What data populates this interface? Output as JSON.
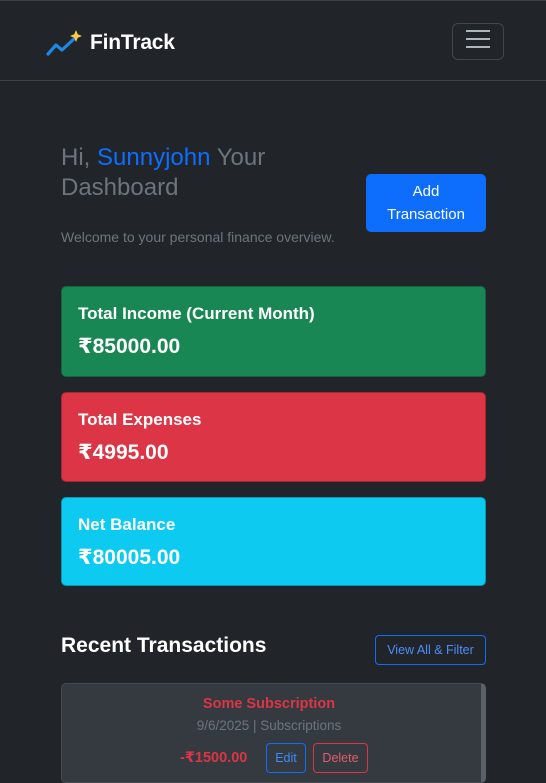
{
  "navbar": {
    "brand_icon": "trend-chart-sparkle-icon",
    "brand_name": "FinTrack",
    "menu_icon": "hamburger-menu-icon"
  },
  "header": {
    "greeting": "Hi,",
    "username": "Sunnyjohn",
    "title_rest": "Your Dashboard",
    "subtitle": "Welcome to your personal finance overview.",
    "add_button": "Add Transaction"
  },
  "cards": {
    "income": {
      "label": "Total Income (Current Month)",
      "value": "₹85000.00",
      "color": "#198754"
    },
    "expenses": {
      "label": "Total Expenses",
      "value": "₹4995.00",
      "color": "#dc3545"
    },
    "balance": {
      "label": "Net Balance",
      "value": "₹80005.00",
      "color": "#0dcaf0"
    }
  },
  "recent": {
    "title": "Recent Transactions",
    "view_all": "View All & Filter",
    "transactions": [
      {
        "name": "Some Subscription",
        "meta": "9/6/2025 | Subscriptions",
        "amount": "-₹1500.00",
        "edit": "Edit",
        "delete": "Delete"
      }
    ]
  },
  "colors": {
    "background": "#212529",
    "primary": "#0d6efd",
    "muted": "#6c757d"
  }
}
